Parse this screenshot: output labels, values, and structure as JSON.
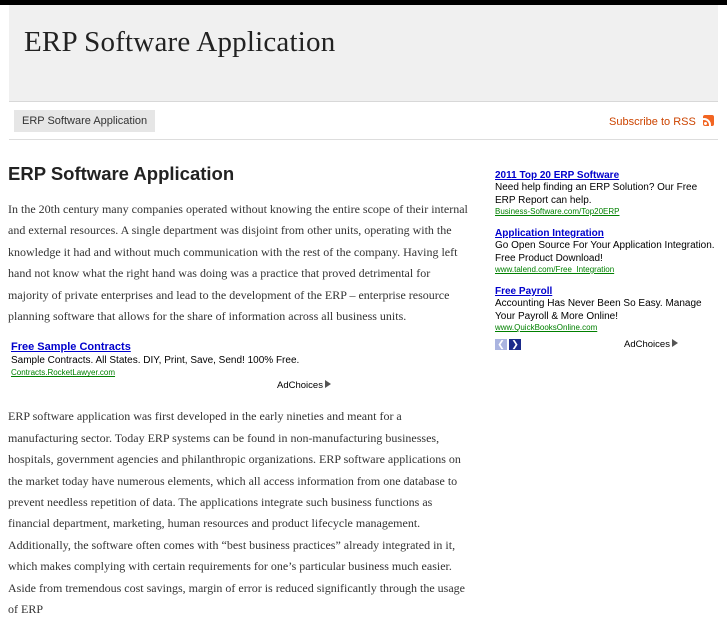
{
  "site": {
    "title": "ERP Software Application"
  },
  "nav": {
    "tab_label": "ERP Software Application",
    "rss_label": "Subscribe to RSS"
  },
  "post": {
    "title": "ERP Software Application",
    "paragraph1": "In the 20th century many companies operated without knowing the entire scope of their internal and external resources. A single department was disjoint from other units, operating with the knowledge it had and without much communication with the rest of the company. Having left hand not know what the right hand was doing was a practice that proved detrimental for majority of private enterprises and lead to the development of the ERP – enterprise resource planning software that allows for the share of information across all business units.",
    "paragraph2": "ERP software application was first developed in the early nineties and meant for a manufacturing sector. Today ERP systems can be found in non-manufacturing businesses, hospitals, government agencies and philanthropic organizations. ERP software applications on the market today have numerous elements, which all access information from one database to prevent needless repetition of data. The applications integrate such business functions as financial department, marketing, human resources and product lifecycle management. Additionally, the software often comes with “best business practices” already integrated in it, which makes complying with certain requirements for one’s particular business much easier. Aside from tremendous cost savings, margin of error is reduced significantly through the usage of ERP"
  },
  "inline_ad": {
    "title": "Free Sample Contracts",
    "desc": "Sample Contracts. All States. DIY, Print, Save, Send! 100% Free.",
    "url": "Contracts.RocketLawyer.com",
    "adchoices": "AdChoices"
  },
  "sidebar": {
    "ads": [
      {
        "title": "2011 Top 20 ERP Software",
        "desc": "Need help finding an ERP Solution? Our Free ERP Report can help.",
        "url": "Business-Software.com/Top20ERP"
      },
      {
        "title": "Application Integration",
        "desc": "Go Open Source For Your Application Integration. Free Product Download!",
        "url": "www.talend.com/Free_Integration"
      },
      {
        "title": "Free Payroll",
        "desc": "Accounting Has Never Been So Easy. Manage Your Payroll & More Online!",
        "url": "www.QuickBooksOnline.com"
      }
    ],
    "adchoices": "AdChoices",
    "prev_icon": "chevron-left-icon",
    "next_icon": "chevron-right-icon"
  },
  "colors": {
    "link": "#0000cc",
    "ad_url": "#008000",
    "rss": "#cc4400",
    "rss_icon": "#f26522",
    "header_bg": "#f0f0f0"
  }
}
